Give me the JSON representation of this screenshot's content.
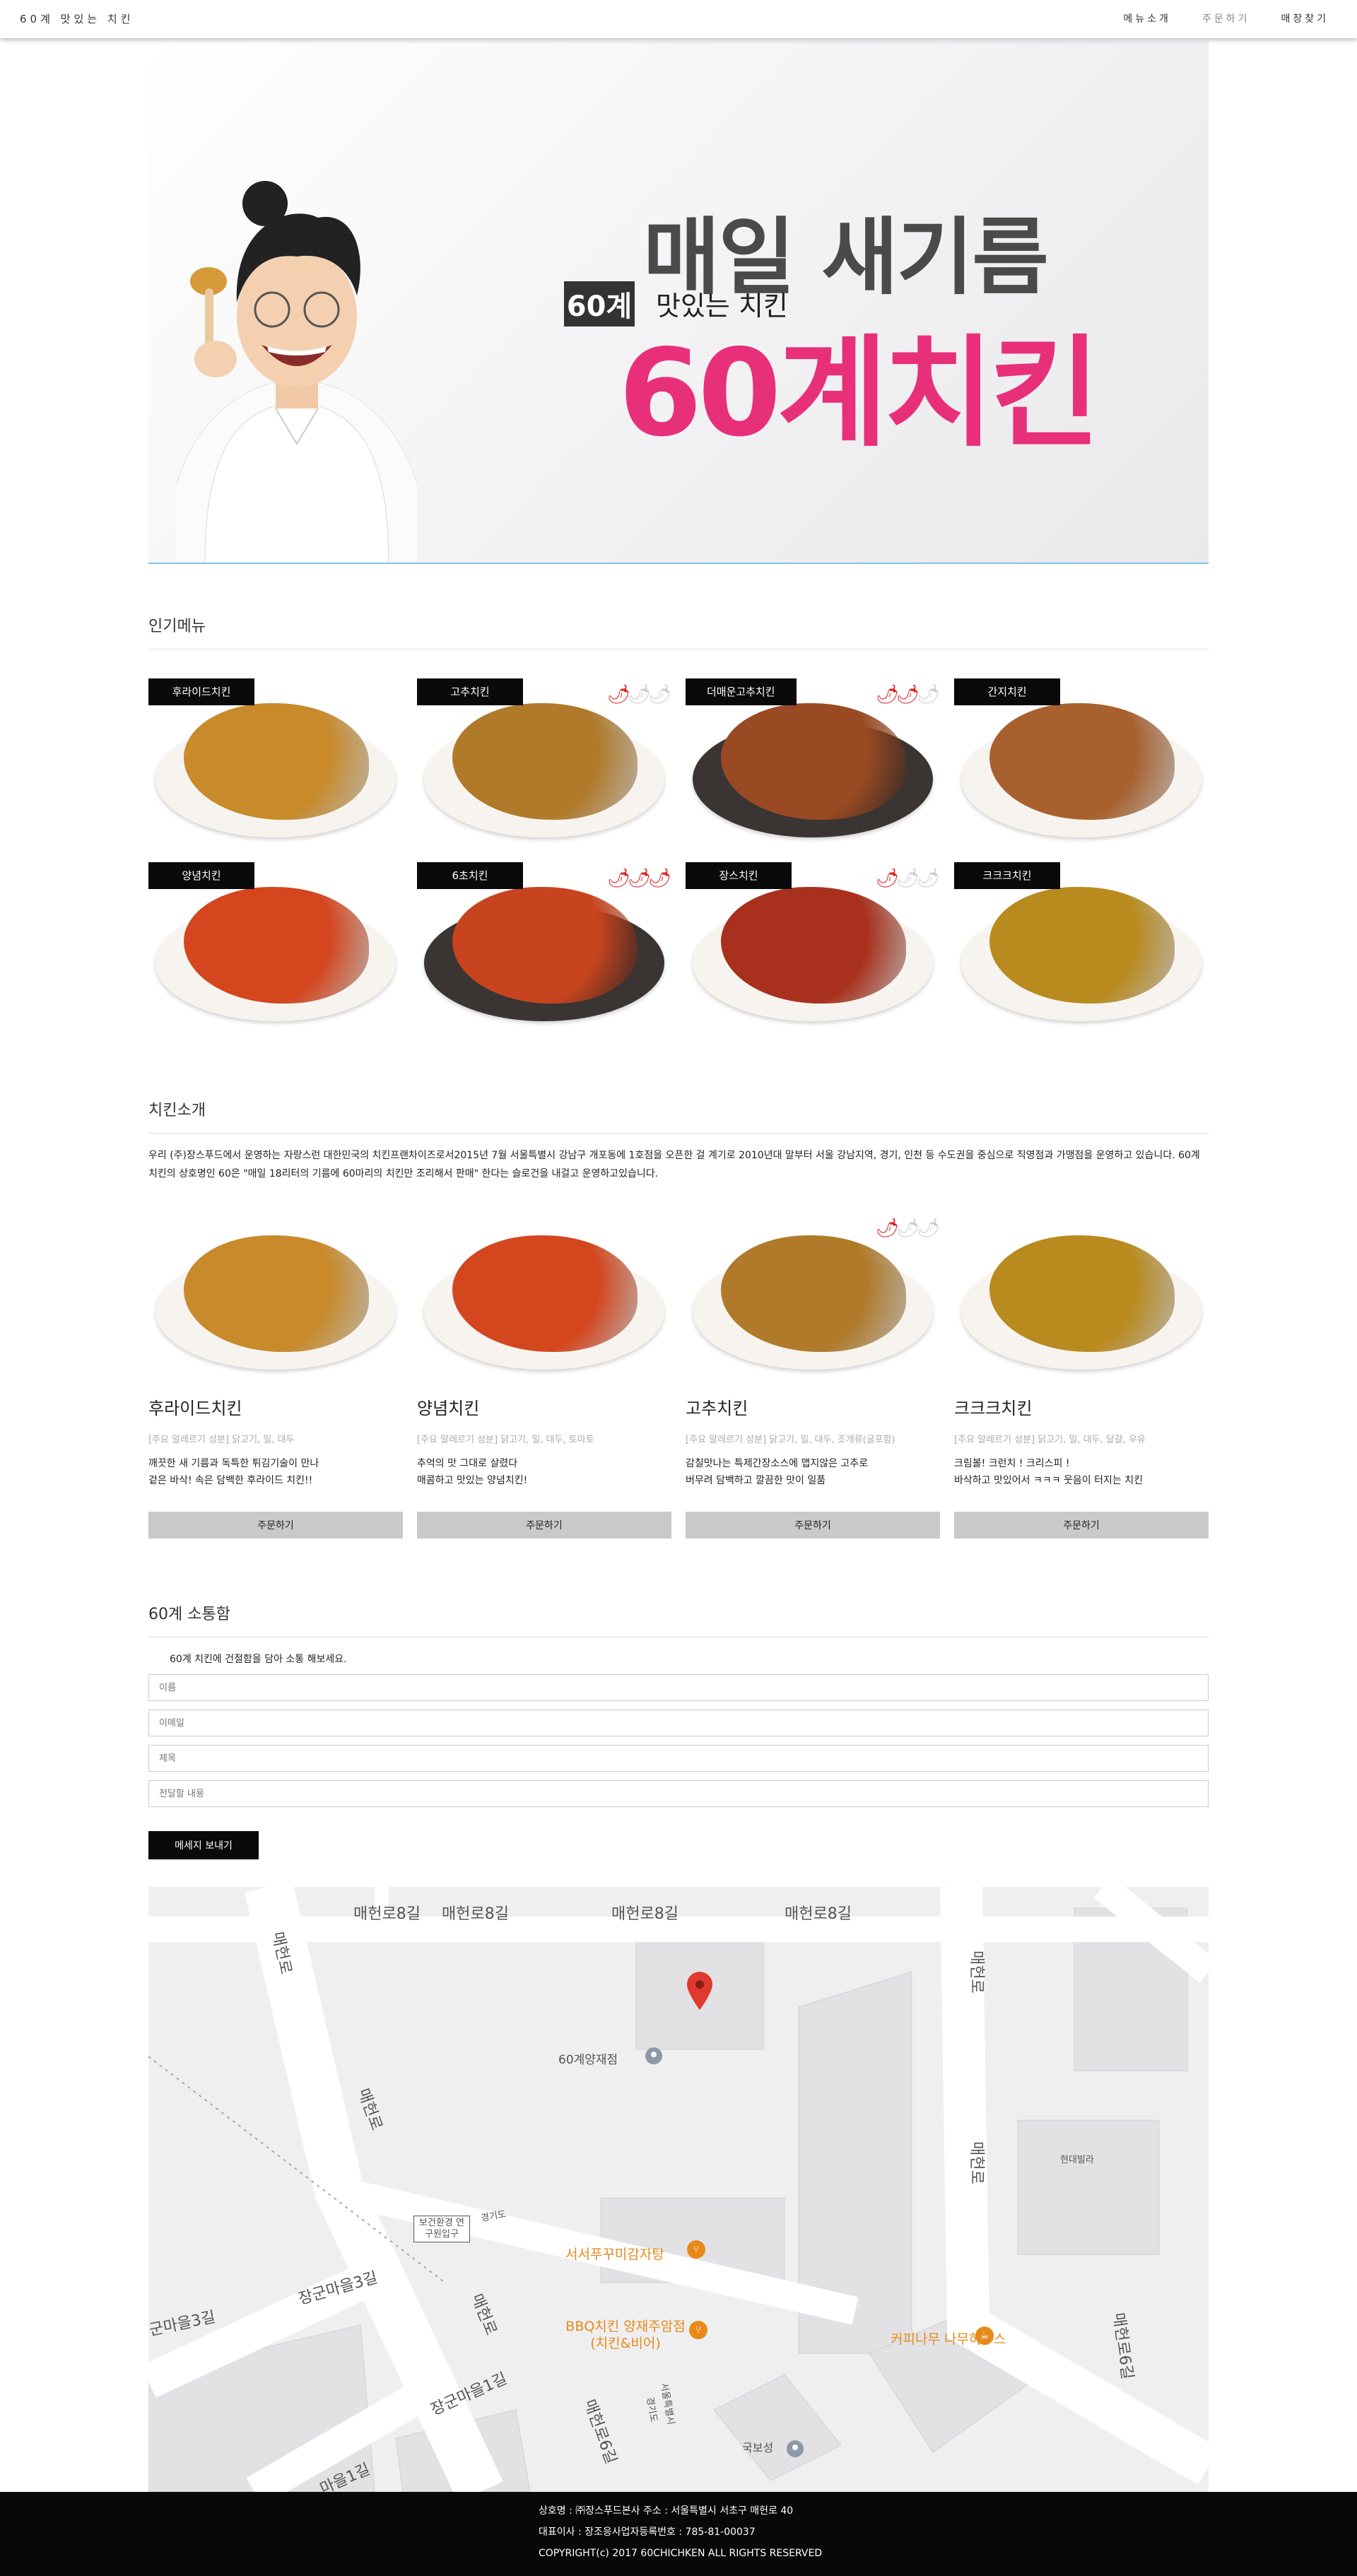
{
  "header": {
    "brand": "60계 맛있는 치킨",
    "nav": [
      "메뉴소개",
      "주문하기",
      "매장찾기"
    ]
  },
  "hero": {
    "headline": "매일 새기름",
    "badge": "60계",
    "subtitle": "맛있는 치킨",
    "big_title": "60계치킨"
  },
  "popular": {
    "title": "인기메뉴",
    "items": [
      {
        "label": "후라이드치킨",
        "heat": 0,
        "color": "#c88a2a",
        "dark": false
      },
      {
        "label": "고추치킨",
        "heat": 1,
        "color": "#b07a2a",
        "dark": false
      },
      {
        "label": "더매운고추치킨",
        "heat": 2,
        "color": "#9a4a22",
        "dark": true
      },
      {
        "label": "간지치킨",
        "heat": 0,
        "color": "#a8602e",
        "dark": false
      },
      {
        "label": "양념치킨",
        "heat": 0,
        "color": "#d4461e",
        "dark": false
      },
      {
        "label": "6초치킨",
        "heat": 3,
        "color": "#c8441e",
        "dark": true
      },
      {
        "label": "장스치킨",
        "heat": 1,
        "color": "#a8301c",
        "dark": false
      },
      {
        "label": "크크크치킨",
        "heat": 0,
        "color": "#b98a1e",
        "dark": false
      }
    ]
  },
  "intro": {
    "title": "치킨소개",
    "text": "우리 (주)장스푸드에서 운영하는 자랑스런 대한민국의 치킨프랜차이즈로서2015년 7월 서울특별시 강남구 개포동에 1호점을 오픈한 걸 계기로 2010년대 말부터 서울 강남지역, 경기, 인천 등 수도권을 중심으로 직영점과 가맹점을 운영하고 있습니다. 60계 치킨의 상호명인 60은 \"매일 18리터의 기름에 60마리의 치킨만 조리해서 판매\" 한다는 슬로건을 내걸고 운영하고있습니다.",
    "dishes": [
      {
        "name": "후라이드치킨",
        "tags": "[주요 알레르기 성분] 닭고기, 밀, 대두",
        "desc1": "깨끗한 새 기름과 독특한 튀김기술이 만나",
        "desc2": "겉은 바삭! 속은 담백한 후라이드 치킨!!",
        "button": "주문하기",
        "heat": 0,
        "color": "#c88a2a"
      },
      {
        "name": "양념치킨",
        "tags": "[주요 알레르기 성분] 닭고기, 밀, 대두, 토마토",
        "desc1": "추억의 맛 그대로 살렸다",
        "desc2": "매콤하고 맛있는 양념치킨!",
        "button": "주문하기",
        "heat": 0,
        "color": "#d4461e"
      },
      {
        "name": "고추치킨",
        "tags": "[주요 알레르기 성분] 닭고기, 밀, 대두, 조개류(굴포함)",
        "desc1": "감칠맛나는 특제간장소스에 맵지않은 고추로",
        "desc2": "버무려 담백하고 깔끔한 맛이 일품",
        "button": "주문하기",
        "heat": 1,
        "color": "#b07a2a"
      },
      {
        "name": "크크크치킨",
        "tags": "[주요 알레르기 성분] 닭고기, 밀, 대두, 달걀, 우유",
        "desc1": "크림볼! 크런치 ! 크리스피 !",
        "desc2": "바삭하고 맛있어서 ㅋㅋㅋ 웃음이 터지는 치킨",
        "button": "주문하기",
        "heat": 0,
        "color": "#b98a1e"
      }
    ]
  },
  "contact": {
    "title": "60계 소통함",
    "note": "60계 치킨에 건절함을 담아 소통 해보세요.",
    "placeholders": [
      "이름",
      "이메일",
      "제목",
      "전달할 내용"
    ],
    "button": "메세지 보내기"
  },
  "map": {
    "labels": [
      "매헌로8길",
      "매헌로8길",
      "매헌로8길",
      "매헌로8길",
      "매헌로",
      "매헌로",
      "매헌로",
      "매헌로",
      "매헌로",
      "매헌로6길",
      "장군마을3길",
      "군마을3길",
      "장군마을1길",
      "마을1길",
      "60계양재점",
      "현대빌라",
      "국보성",
      "서울특별시",
      "경기도",
      "경기도",
      "보건환경 연구원입구"
    ],
    "places": [
      "서서푸꾸미감자탕",
      "BBQ치킨 양재주암점 (치킨&비어)",
      "커피나무 나무하우스"
    ]
  },
  "footer": {
    "line1": "상호명 : ㈜장스푸드본사 주소 : 서울특별시 서초구 매헌로 40",
    "line2": "대표이사 : 장조응사업자등록번호 : 785-81-00037",
    "line3": "COPYRIGHT(c) 2017 60CHICHKEN ALL RIGHTS RESERVED"
  }
}
